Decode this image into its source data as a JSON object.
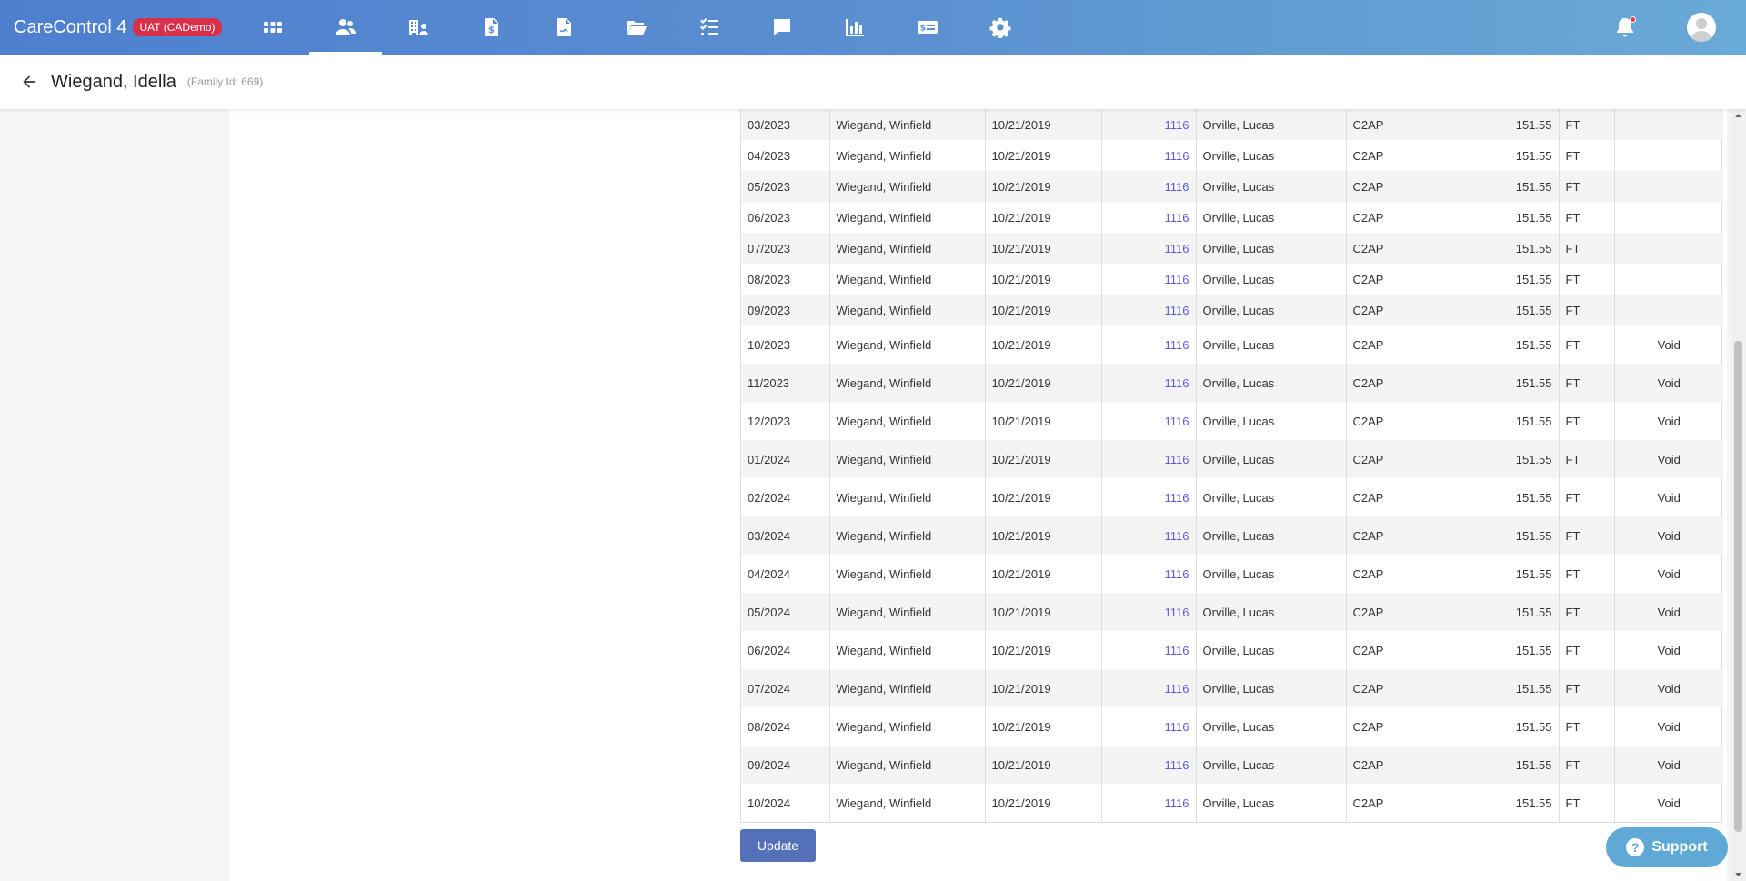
{
  "app": {
    "title": "CareControl 4",
    "env_badge": "UAT (CADemo)"
  },
  "nav": [
    {
      "icon": "apps-grid-icon",
      "active": false
    },
    {
      "icon": "families-icon",
      "active": true
    },
    {
      "icon": "providers-icon",
      "active": false
    },
    {
      "icon": "billing-icon",
      "active": false
    },
    {
      "icon": "contracts-icon",
      "active": false
    },
    {
      "icon": "folder-icon",
      "active": false
    },
    {
      "icon": "tasks-icon",
      "active": false
    },
    {
      "icon": "messages-icon",
      "active": false
    },
    {
      "icon": "reports-icon",
      "active": false
    },
    {
      "icon": "payments-icon",
      "active": false
    },
    {
      "icon": "settings-icon",
      "active": false
    }
  ],
  "colors": {
    "brand_gradient_start": "#4e7fcf",
    "brand_gradient_end": "#6aaad6",
    "env_badge": "#d9304a",
    "link": "#5b5bd6",
    "primary_button": "#5471b8",
    "support": "#5fa9d6"
  },
  "header": {
    "family_name": "Wiegand, Idella",
    "family_id": "(Family Id: 669)"
  },
  "table": {
    "rows": [
      {
        "period": "03/2023",
        "child": "Wiegand, Winfield",
        "date": "10/21/2019",
        "id": "1116",
        "provider": "Orville, Lucas",
        "program": "C2AP",
        "amount": "151.55",
        "schedule": "FT",
        "status": ""
      },
      {
        "period": "04/2023",
        "child": "Wiegand, Winfield",
        "date": "10/21/2019",
        "id": "1116",
        "provider": "Orville, Lucas",
        "program": "C2AP",
        "amount": "151.55",
        "schedule": "FT",
        "status": ""
      },
      {
        "period": "05/2023",
        "child": "Wiegand, Winfield",
        "date": "10/21/2019",
        "id": "1116",
        "provider": "Orville, Lucas",
        "program": "C2AP",
        "amount": "151.55",
        "schedule": "FT",
        "status": ""
      },
      {
        "period": "06/2023",
        "child": "Wiegand, Winfield",
        "date": "10/21/2019",
        "id": "1116",
        "provider": "Orville, Lucas",
        "program": "C2AP",
        "amount": "151.55",
        "schedule": "FT",
        "status": ""
      },
      {
        "period": "07/2023",
        "child": "Wiegand, Winfield",
        "date": "10/21/2019",
        "id": "1116",
        "provider": "Orville, Lucas",
        "program": "C2AP",
        "amount": "151.55",
        "schedule": "FT",
        "status": ""
      },
      {
        "period": "08/2023",
        "child": "Wiegand, Winfield",
        "date": "10/21/2019",
        "id": "1116",
        "provider": "Orville, Lucas",
        "program": "C2AP",
        "amount": "151.55",
        "schedule": "FT",
        "status": ""
      },
      {
        "period": "09/2023",
        "child": "Wiegand, Winfield",
        "date": "10/21/2019",
        "id": "1116",
        "provider": "Orville, Lucas",
        "program": "C2AP",
        "amount": "151.55",
        "schedule": "FT",
        "status": ""
      },
      {
        "period": "10/2023",
        "child": "Wiegand, Winfield",
        "date": "10/21/2019",
        "id": "1116",
        "provider": "Orville, Lucas",
        "program": "C2AP",
        "amount": "151.55",
        "schedule": "FT",
        "status": "Void"
      },
      {
        "period": "11/2023",
        "child": "Wiegand, Winfield",
        "date": "10/21/2019",
        "id": "1116",
        "provider": "Orville, Lucas",
        "program": "C2AP",
        "amount": "151.55",
        "schedule": "FT",
        "status": "Void"
      },
      {
        "period": "12/2023",
        "child": "Wiegand, Winfield",
        "date": "10/21/2019",
        "id": "1116",
        "provider": "Orville, Lucas",
        "program": "C2AP",
        "amount": "151.55",
        "schedule": "FT",
        "status": "Void"
      },
      {
        "period": "01/2024",
        "child": "Wiegand, Winfield",
        "date": "10/21/2019",
        "id": "1116",
        "provider": "Orville, Lucas",
        "program": "C2AP",
        "amount": "151.55",
        "schedule": "FT",
        "status": "Void"
      },
      {
        "period": "02/2024",
        "child": "Wiegand, Winfield",
        "date": "10/21/2019",
        "id": "1116",
        "provider": "Orville, Lucas",
        "program": "C2AP",
        "amount": "151.55",
        "schedule": "FT",
        "status": "Void"
      },
      {
        "period": "03/2024",
        "child": "Wiegand, Winfield",
        "date": "10/21/2019",
        "id": "1116",
        "provider": "Orville, Lucas",
        "program": "C2AP",
        "amount": "151.55",
        "schedule": "FT",
        "status": "Void"
      },
      {
        "period": "04/2024",
        "child": "Wiegand, Winfield",
        "date": "10/21/2019",
        "id": "1116",
        "provider": "Orville, Lucas",
        "program": "C2AP",
        "amount": "151.55",
        "schedule": "FT",
        "status": "Void"
      },
      {
        "period": "05/2024",
        "child": "Wiegand, Winfield",
        "date": "10/21/2019",
        "id": "1116",
        "provider": "Orville, Lucas",
        "program": "C2AP",
        "amount": "151.55",
        "schedule": "FT",
        "status": "Void"
      },
      {
        "period": "06/2024",
        "child": "Wiegand, Winfield",
        "date": "10/21/2019",
        "id": "1116",
        "provider": "Orville, Lucas",
        "program": "C2AP",
        "amount": "151.55",
        "schedule": "FT",
        "status": "Void"
      },
      {
        "period": "07/2024",
        "child": "Wiegand, Winfield",
        "date": "10/21/2019",
        "id": "1116",
        "provider": "Orville, Lucas",
        "program": "C2AP",
        "amount": "151.55",
        "schedule": "FT",
        "status": "Void"
      },
      {
        "period": "08/2024",
        "child": "Wiegand, Winfield",
        "date": "10/21/2019",
        "id": "1116",
        "provider": "Orville, Lucas",
        "program": "C2AP",
        "amount": "151.55",
        "schedule": "FT",
        "status": "Void"
      },
      {
        "period": "09/2024",
        "child": "Wiegand, Winfield",
        "date": "10/21/2019",
        "id": "1116",
        "provider": "Orville, Lucas",
        "program": "C2AP",
        "amount": "151.55",
        "schedule": "FT",
        "status": "Void"
      },
      {
        "period": "10/2024",
        "child": "Wiegand, Winfield",
        "date": "10/21/2019",
        "id": "1116",
        "provider": "Orville, Lucas",
        "program": "C2AP",
        "amount": "151.55",
        "schedule": "FT",
        "status": "Void"
      }
    ]
  },
  "actions": {
    "update_label": "Update"
  },
  "support": {
    "label": "Support",
    "icon_glyph": "?"
  }
}
